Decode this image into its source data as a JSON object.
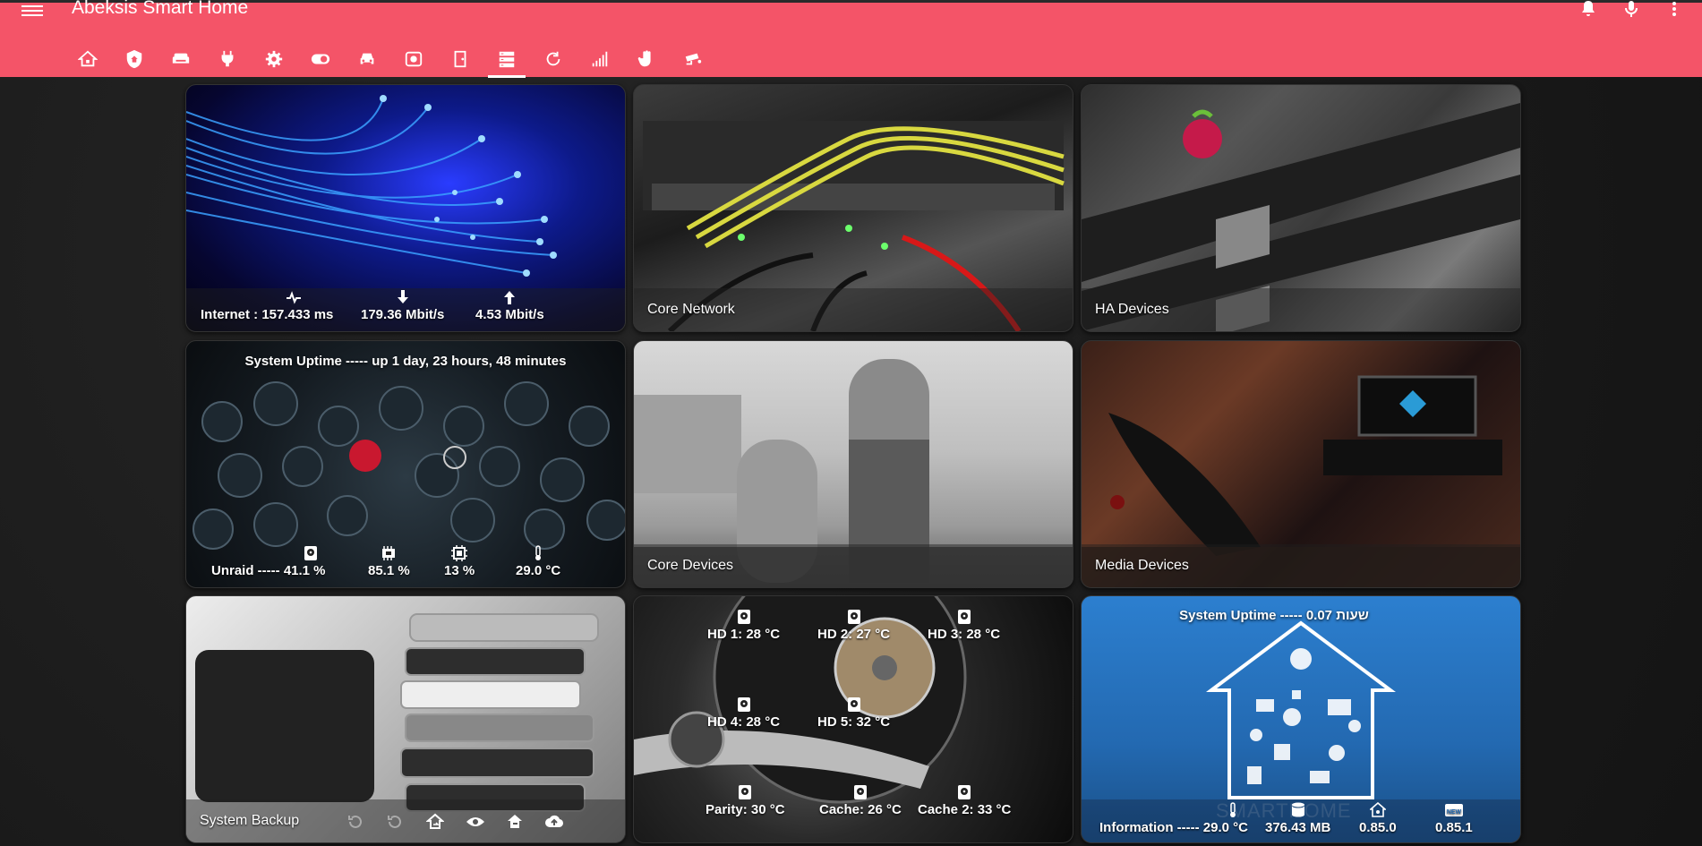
{
  "app": {
    "title": "Abeksis Smart Home"
  },
  "colors": {
    "header": "#f45468",
    "background": "#1b1b1b",
    "accent": "#ffffff"
  },
  "topbar": {
    "icons": [
      "bell-icon",
      "microphone-icon",
      "more-vert-icon"
    ]
  },
  "tabs": [
    {
      "icon": "home-icon"
    },
    {
      "icon": "shield-home-icon"
    },
    {
      "icon": "sofa-icon"
    },
    {
      "icon": "power-plug-icon"
    },
    {
      "icon": "gear-icon"
    },
    {
      "icon": "toggle-switch-icon"
    },
    {
      "icon": "car-icon"
    },
    {
      "icon": "cctv-icon"
    },
    {
      "icon": "door-icon"
    },
    {
      "icon": "server-icon",
      "active": true
    },
    {
      "icon": "refresh-icon"
    },
    {
      "icon": "signal-icon"
    },
    {
      "icon": "hand-icon"
    },
    {
      "icon": "security-camera-icon"
    }
  ],
  "cards": {
    "internet": {
      "ping_label": "Internet : 157.433 ms",
      "download": "179.36 Mbit/s",
      "upload": "4.53 Mbit/s"
    },
    "core_network": {
      "caption": "Core Network"
    },
    "ha_devices": {
      "caption": "HA Devices"
    },
    "uptime": {
      "header": "System Uptime ----- up 1 day, 23 hours, 48 minutes",
      "unraid": "Unraid ----- 41.1 %",
      "ram": "85.1 %",
      "cpu": "13 %",
      "temp": "29.0 °C"
    },
    "core_devices": {
      "caption": "Core Devices"
    },
    "media_devices": {
      "caption": "Media Devices"
    },
    "system_backup": {
      "caption": "System Backup",
      "buttons": [
        "history-icon",
        "history-icon",
        "home-export-icon",
        "eye-icon",
        "home-import-icon",
        "cloud-upload-icon"
      ]
    },
    "disks": {
      "hd1": "HD 1: 28 °C",
      "hd2": "HD 2: 27 °C",
      "hd3": "HD 3: 28 °C",
      "hd4": "HD 4: 28 °C",
      "hd5": "HD 5: 32 °C",
      "parity": "Parity: 30 °C",
      "cache": "Cache: 26 °C",
      "cache2": "Cache 2: 33 °C"
    },
    "information": {
      "header": "System Uptime ----- 0.07 שעות",
      "label": "Information ----- 29.0 °C",
      "db": "376.43 MB",
      "version": "0.85.0",
      "new_version": "0.85.1",
      "watermark": "SMARTHOME"
    }
  }
}
